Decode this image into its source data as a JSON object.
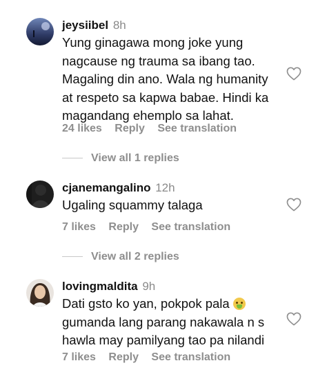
{
  "comments": [
    {
      "username": "jeysiibel",
      "time": "8h",
      "text_lines": [
        "Yung ginagawa mong joke yung",
        "nagcause ng trauma sa ibang tao.",
        "Magaling din ano. Wala ng humanity",
        "at respeto sa kapwa babae. Hindi ka",
        "magandang ehemplo sa lahat."
      ],
      "likes": "24 likes",
      "reply": "Reply",
      "see_translation": "See translation",
      "view_replies": "View all 1 replies"
    },
    {
      "username": "cjanemangalino",
      "time": "12h",
      "text_lines": [
        "Ugaling squammy talaga"
      ],
      "likes": "7 likes",
      "reply": "Reply",
      "see_translation": "See translation",
      "view_replies": "View all 2 replies"
    },
    {
      "username": "lovingmaldita",
      "time": "9h",
      "text_lines": [
        "Dati gsto ko yan, pokpok pala",
        "gumanda lang parang nakawala n s",
        "hawla may pamilyang tao pa nilandi"
      ],
      "likes": "7 likes",
      "reply": "Reply",
      "see_translation": "See translation"
    }
  ],
  "colors": {
    "muted_text": "#8e8e8e",
    "heart_stroke": "#8e8e8e"
  },
  "icons": {
    "like": "heart-outline-icon",
    "emoji": "nauseated-face-emoji-icon"
  }
}
